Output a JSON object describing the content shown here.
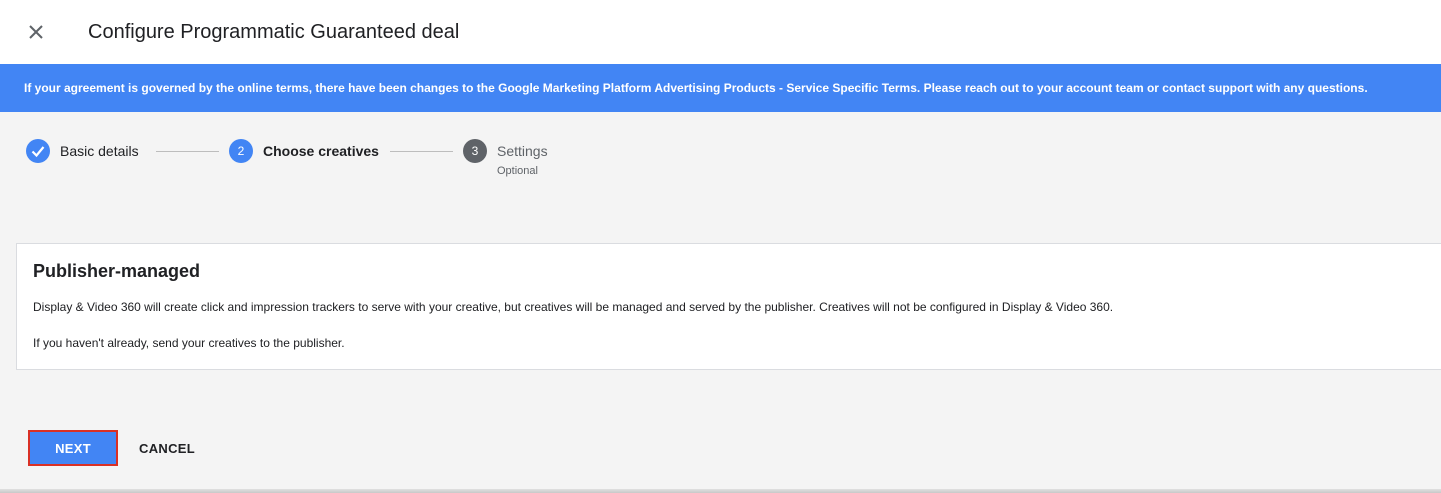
{
  "header": {
    "title": "Configure Programmatic Guaranteed deal",
    "close_icon": "close-icon"
  },
  "banner": {
    "text": "If your agreement is governed by the online terms, there have been changes to the Google Marketing Platform Advertising Products - Service Specific Terms. Please reach out to your account team or contact support with any questions.",
    "color": "#4285f4"
  },
  "stepper": {
    "steps": [
      {
        "label": "Basic details",
        "state": "completed",
        "icon": "check-icon"
      },
      {
        "label": "Choose creatives",
        "state": "active",
        "number": "2"
      },
      {
        "label": "Settings",
        "state": "pending",
        "number": "3",
        "sublabel": "Optional"
      }
    ]
  },
  "card": {
    "title": "Publisher-managed",
    "description": "Display & Video 360 will create click and impression trackers to serve with your creative, but creatives will be managed and served by the publisher. Creatives will not be configured in Display & Video 360.",
    "note": "If you haven't already, send your creatives to the publisher."
  },
  "footer": {
    "next_label": "NEXT",
    "cancel_label": "CANCEL"
  },
  "colors": {
    "accent": "#4285f4",
    "highlight_border": "#d93025",
    "pending_step": "#5f6368"
  }
}
